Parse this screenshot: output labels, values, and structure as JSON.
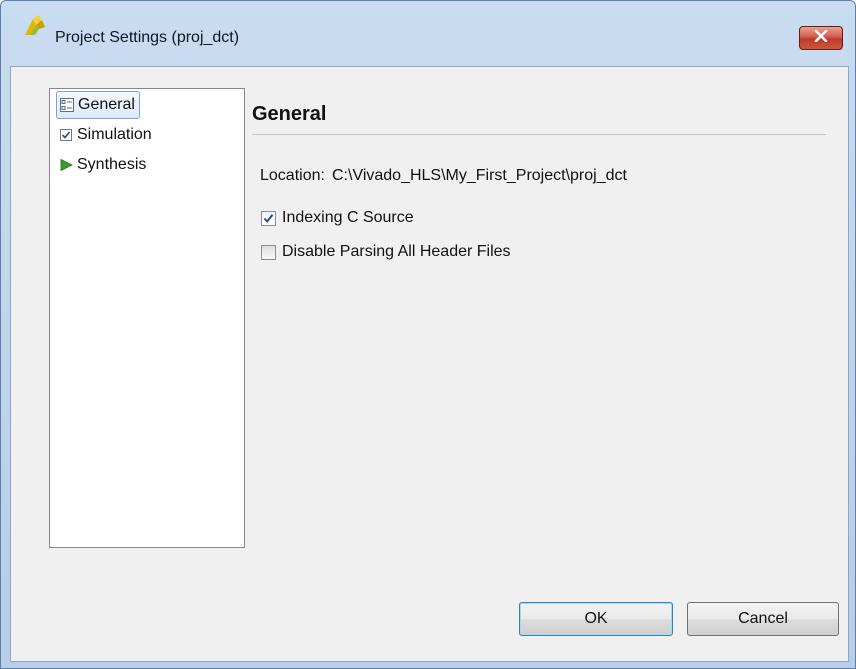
{
  "window": {
    "title": "Project Settings (proj_dct)"
  },
  "sidebar": {
    "items": [
      {
        "label": "General",
        "icon": "general-settings-icon",
        "selected": true
      },
      {
        "label": "Simulation",
        "icon": "checkbox-icon",
        "selected": false
      },
      {
        "label": "Synthesis",
        "icon": "green-play-icon",
        "selected": false
      }
    ]
  },
  "main": {
    "section_title": "General",
    "location_label": "Location:",
    "location_value": "C:\\Vivado_HLS\\My_First_Project\\proj_dct",
    "options": [
      {
        "label": "Indexing C Source",
        "checked": true
      },
      {
        "label": "Disable Parsing All Header Files",
        "checked": false
      }
    ]
  },
  "buttons": {
    "ok": "OK",
    "cancel": "Cancel"
  },
  "colors": {
    "titlebar": "#c9dcf1",
    "close_button": "#c0392b",
    "client_bg": "#f0f0f0",
    "selection": "#dcebfc",
    "synthesis_icon": "#3a9a2e"
  }
}
